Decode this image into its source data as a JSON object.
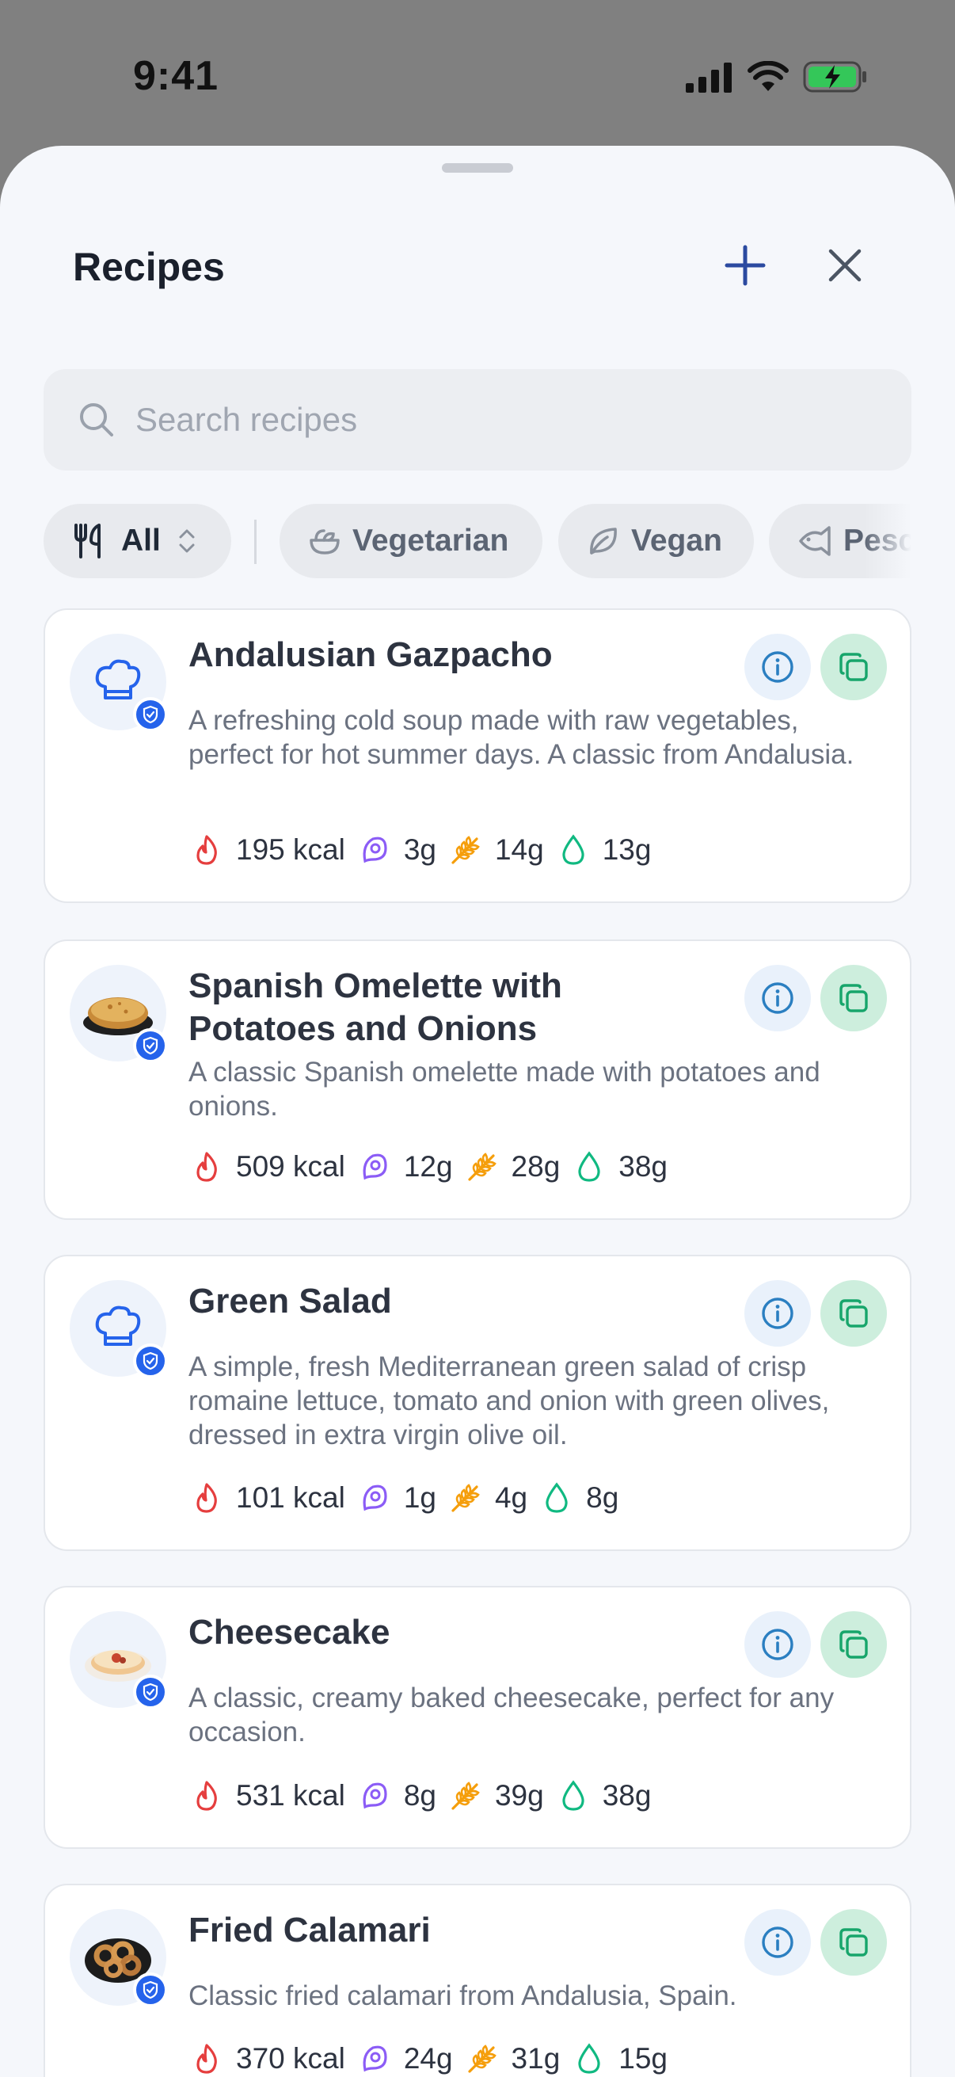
{
  "status": {
    "time": "9:41"
  },
  "header": {
    "title": "Recipes"
  },
  "search": {
    "placeholder": "Search recipes",
    "value": ""
  },
  "filters": [
    {
      "label": "All",
      "icon": "utensils-icon",
      "selected": true
    },
    {
      "label": "Vegetarian",
      "icon": "salad-bowl-icon"
    },
    {
      "label": "Vegan",
      "icon": "leaf-icon"
    },
    {
      "label": "Pesc",
      "icon": "fish-icon"
    }
  ],
  "recipes": [
    {
      "title": "Andalusian Gazpacho",
      "description": "A refreshing cold soup made with raw vegetables, perfect for hot summer days. A classic from Andalusia.",
      "kcal": "195 kcal",
      "protein": "3g",
      "carbs": "14g",
      "fat": "13g",
      "image": "chef-hat-icon"
    },
    {
      "title": "Spanish Omelette with Potatoes and Onions",
      "description": "A classic Spanish omelette made with potatoes and onions.",
      "kcal": "509 kcal",
      "protein": "12g",
      "carbs": "28g",
      "fat": "38g",
      "image": "omelette-photo"
    },
    {
      "title": "Green Salad",
      "description": "A simple, fresh Mediterranean green salad of crisp romaine lettuce, tomato and onion with green olives, dressed in extra virgin olive oil.",
      "kcal": "101 kcal",
      "protein": "1g",
      "carbs": "4g",
      "fat": "8g",
      "image": "chef-hat-icon"
    },
    {
      "title": "Cheesecake",
      "description": "A classic, creamy baked cheesecake, perfect for any occasion.",
      "kcal": "531 kcal",
      "protein": "8g",
      "carbs": "39g",
      "fat": "38g",
      "image": "cheesecake-photo"
    },
    {
      "title": "Fried Calamari",
      "description": "Classic fried calamari from Andalusia, Spain.",
      "kcal": "370 kcal",
      "protein": "24g",
      "carbs": "31g",
      "fat": "15g",
      "image": "calamari-photo"
    }
  ],
  "colors": {
    "accent": "#2b4aa0",
    "calories": "#e53e3e",
    "protein": "#8b5cf6",
    "carbs": "#f59e0b",
    "fat": "#10b981",
    "verified_badge": "#2563eb"
  }
}
